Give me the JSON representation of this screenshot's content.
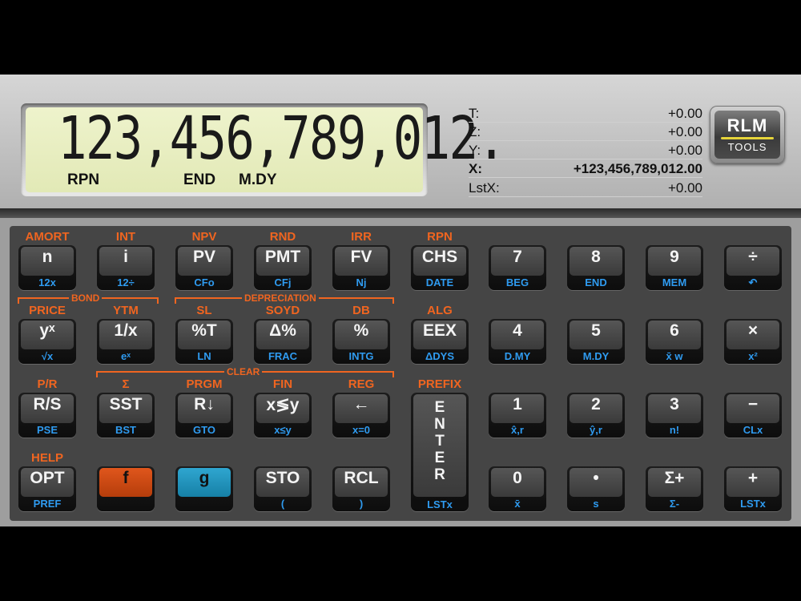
{
  "display": {
    "digits": "123,456,789,012.",
    "annunciators": [
      "RPN",
      "END",
      "M.DY"
    ]
  },
  "stack": [
    {
      "label": "T:",
      "value": "+0.00"
    },
    {
      "label": "Z:",
      "value": "+0.00"
    },
    {
      "label": "Y:",
      "value": "+0.00"
    },
    {
      "label": "X:",
      "value": "+123,456,789,012.00"
    },
    {
      "label": "LstX:",
      "value": "+0.00"
    }
  ],
  "logo": {
    "line1": "RLM",
    "line2": "TOOLS"
  },
  "rows": [
    {
      "f_labels": [
        "AMORT",
        "INT",
        "NPV",
        "RND",
        "IRR",
        "RPN",
        "",
        "",
        "",
        ""
      ],
      "keys": [
        {
          "main": "n",
          "sub": "12x"
        },
        {
          "main": "i",
          "sub": "12÷"
        },
        {
          "main": "PV",
          "sub": "CFo"
        },
        {
          "main": "PMT",
          "sub": "CFj"
        },
        {
          "main": "FV",
          "sub": "Nj"
        },
        {
          "main": "CHS",
          "sub": "DATE"
        },
        {
          "main": "7",
          "sub": "BEG"
        },
        {
          "main": "8",
          "sub": "END"
        },
        {
          "main": "9",
          "sub": "MEM"
        },
        {
          "main": "÷",
          "sub": "↶"
        }
      ]
    },
    {
      "f_labels": [
        "PRICE",
        "YTM",
        "SL",
        "SOYD",
        "DB",
        "ALG",
        "",
        "",
        "",
        ""
      ],
      "keys": [
        {
          "main": "yˣ",
          "sub": "√x"
        },
        {
          "main": "1/x",
          "sub": "eˣ"
        },
        {
          "main": "%T",
          "sub": "LN"
        },
        {
          "main": "Δ%",
          "sub": "FRAC"
        },
        {
          "main": "%",
          "sub": "INTG"
        },
        {
          "main": "EEX",
          "sub": "ΔDYS"
        },
        {
          "main": "4",
          "sub": "D.MY"
        },
        {
          "main": "5",
          "sub": "M.DY"
        },
        {
          "main": "6",
          "sub": "x̄ w"
        },
        {
          "main": "×",
          "sub": "x²"
        }
      ]
    },
    {
      "f_labels": [
        "P/R",
        "Σ",
        "PRGM",
        "FIN",
        "REG",
        "PREFIX",
        "",
        "",
        "",
        ""
      ],
      "keys": [
        {
          "main": "R/S",
          "sub": "PSE"
        },
        {
          "main": "SST",
          "sub": "BST"
        },
        {
          "main": "R↓",
          "sub": "GTO"
        },
        {
          "main": "x≶y",
          "sub": "x≤y"
        },
        {
          "main": "←",
          "sub": "x=0"
        },
        {
          "main": "",
          "sub": ""
        },
        {
          "main": "1",
          "sub": "x̂,r"
        },
        {
          "main": "2",
          "sub": "ŷ,r"
        },
        {
          "main": "3",
          "sub": "n!"
        },
        {
          "main": "−",
          "sub": "CLx"
        }
      ]
    },
    {
      "f_labels": [
        "HELP",
        "",
        "",
        "",
        "",
        "",
        "",
        "",
        "",
        ""
      ],
      "keys": [
        {
          "main": "OPT",
          "sub": "PREF"
        },
        {
          "main": "f",
          "sub": ""
        },
        {
          "main": "g",
          "sub": ""
        },
        {
          "main": "STO",
          "sub": "("
        },
        {
          "main": "RCL",
          "sub": ")"
        },
        {
          "main": "",
          "sub": ""
        },
        {
          "main": "0",
          "sub": "x̄"
        },
        {
          "main": "•",
          "sub": "s"
        },
        {
          "main": "Σ+",
          "sub": "Σ-"
        },
        {
          "main": "+",
          "sub": "LSTx"
        }
      ]
    }
  ],
  "enter_key": {
    "letters": [
      "E",
      "N",
      "T",
      "E",
      "R"
    ],
    "sub": "LSTx"
  },
  "brackets": {
    "bond": "BOND",
    "depreciation": "DEPRECIATION",
    "clear": "CLEAR"
  },
  "colors": {
    "f_orange": "#f06520",
    "g_blue": "#2f9bf0",
    "lcd": "#e8eec0"
  }
}
